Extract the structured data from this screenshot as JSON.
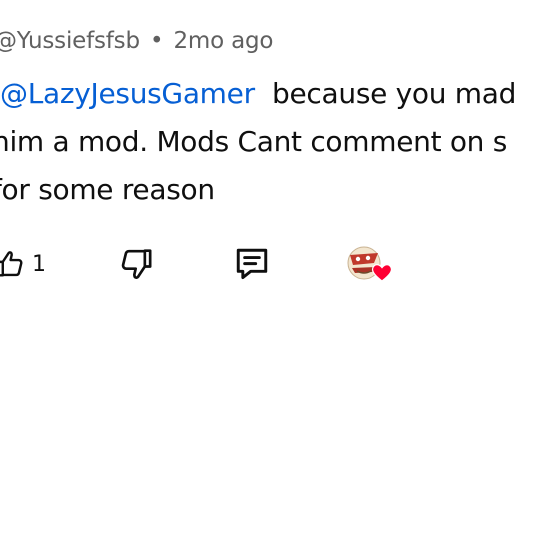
{
  "comment": {
    "author": "@Yussiefsfsb",
    "separator": "•",
    "time": "2mo ago",
    "mention": "@LazyJesusGamer",
    "text_line1": "because you mad",
    "text_line2": "him a mod. Mods Cant comment on s",
    "text_line3": "for some reason"
  },
  "actions": {
    "like_count": "1",
    "like_icon": "thumbs-up-icon",
    "dislike_icon": "thumbs-down-icon",
    "reply_icon": "comment-icon",
    "heart_icon": "creator-heart-icon"
  },
  "colors": {
    "mention": "#065fd4",
    "meta": "#606060",
    "text": "#0f0f0f",
    "heart": "#ff0033"
  }
}
